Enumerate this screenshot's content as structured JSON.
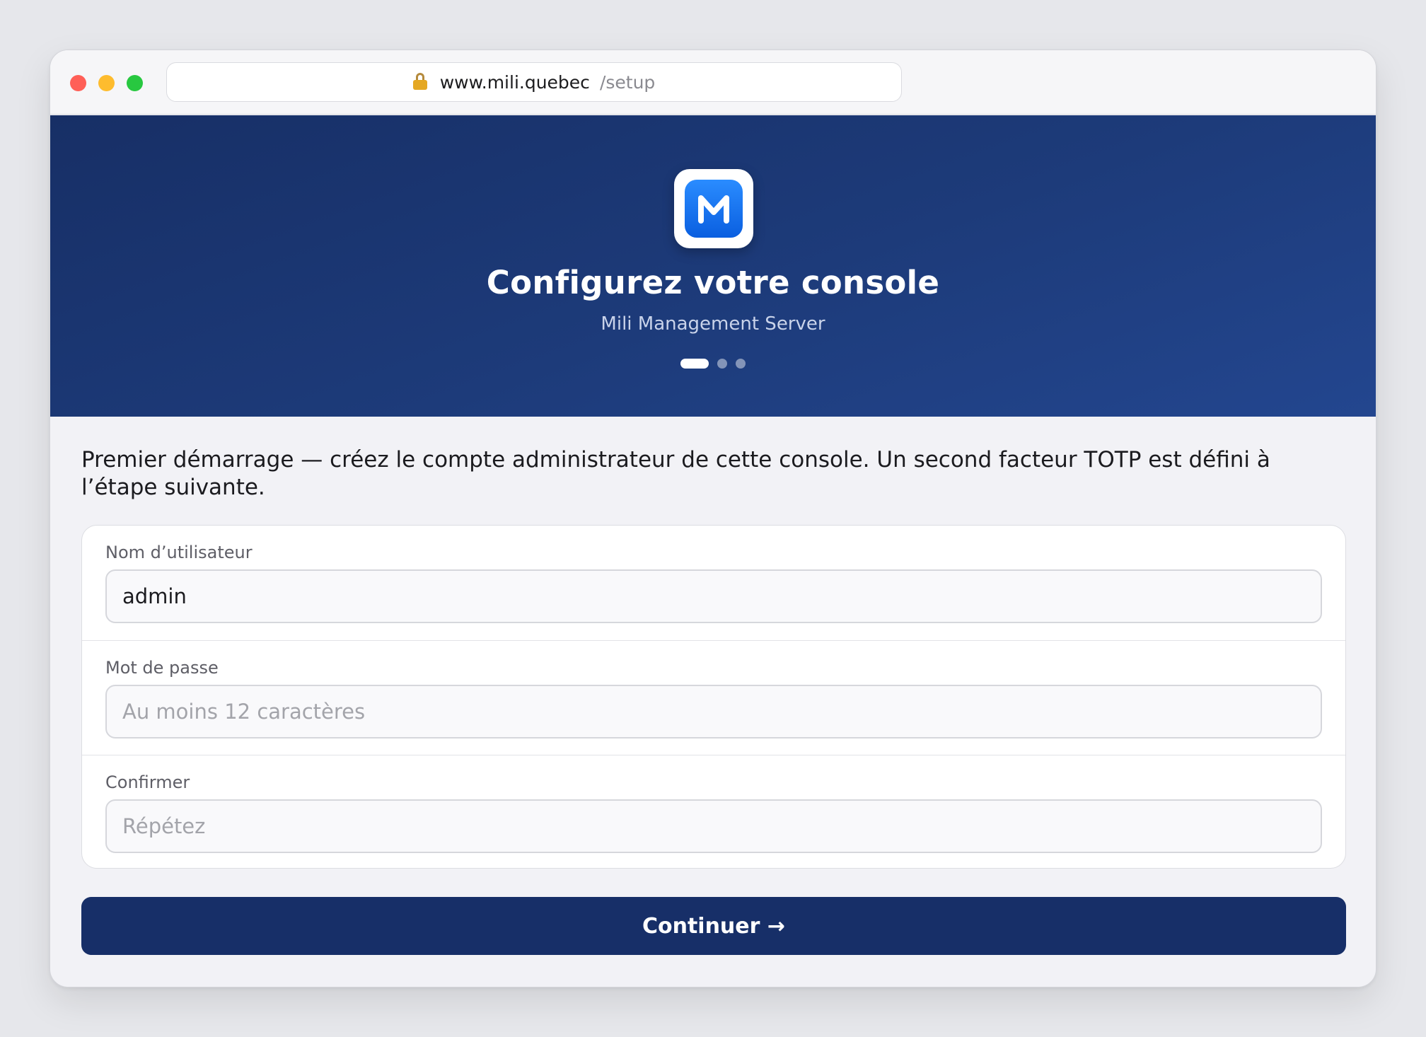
{
  "browser": {
    "url_host": "www.mili.quebec",
    "url_path": "/setup",
    "lock_icon": "lock-icon"
  },
  "hero": {
    "logo_letter": "M",
    "title": "Configurez votre console",
    "subtitle": "Mili Management Server",
    "steps_total": 3,
    "step_current": 1
  },
  "intro": "Premier démarrage — créez le compte administrateur de cette console. Un second facteur TOTP est défini à l’étape suivante.",
  "form": {
    "username": {
      "label": "Nom d’utilisateur",
      "value": "admin",
      "placeholder": ""
    },
    "password": {
      "label": "Mot de passe",
      "value": "",
      "placeholder": "Au moins 12 caractères"
    },
    "confirm": {
      "label": "Confirmer",
      "value": "",
      "placeholder": "Répétez"
    }
  },
  "continue_label": "Continuer →",
  "colors": {
    "hero_bg": "#1d3b7a",
    "accent": "#172f68",
    "logo_blue": "#1a73f0"
  }
}
